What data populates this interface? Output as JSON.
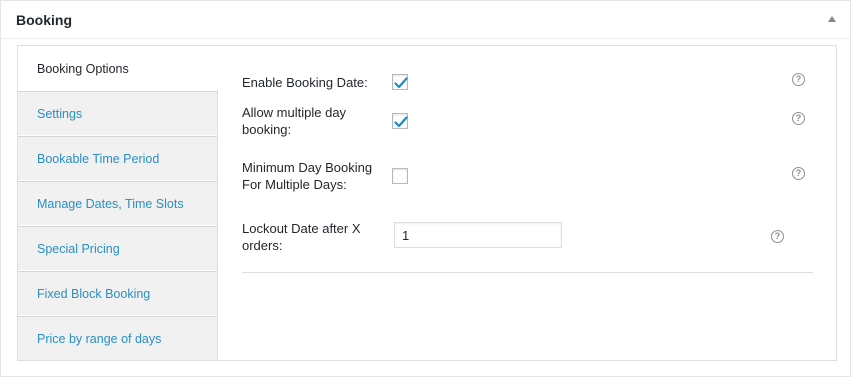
{
  "postbox": {
    "title": "Booking"
  },
  "tabs": [
    {
      "label": "Booking Options",
      "active": true
    },
    {
      "label": "Settings",
      "active": false
    },
    {
      "label": "Bookable Time Period",
      "active": false
    },
    {
      "label": "Manage Dates, Time Slots",
      "active": false
    },
    {
      "label": "Special Pricing",
      "active": false
    },
    {
      "label": "Fixed Block Booking",
      "active": false
    },
    {
      "label": "Price by range of days",
      "active": false
    }
  ],
  "fields": {
    "enable_booking_date": {
      "label": "Enable Booking Date:",
      "checked": true,
      "help": "?"
    },
    "allow_multiple_day": {
      "label": "Allow multiple day booking:",
      "checked": true,
      "help": "?"
    },
    "minimum_day_booking": {
      "label": "Minimum Day Booking For Multiple Days:",
      "checked": false,
      "help": "?"
    },
    "lockout_date": {
      "label": "Lockout Date after X orders:",
      "value": "1",
      "help": "?"
    }
  },
  "colors": {
    "link": "#2a8fc1",
    "check": "#1e8cbe",
    "tab_background": "#f1f1f1"
  },
  "icons": {
    "toggle": "arrow-up-icon",
    "help": "help-icon",
    "check": "checkmark-icon"
  }
}
